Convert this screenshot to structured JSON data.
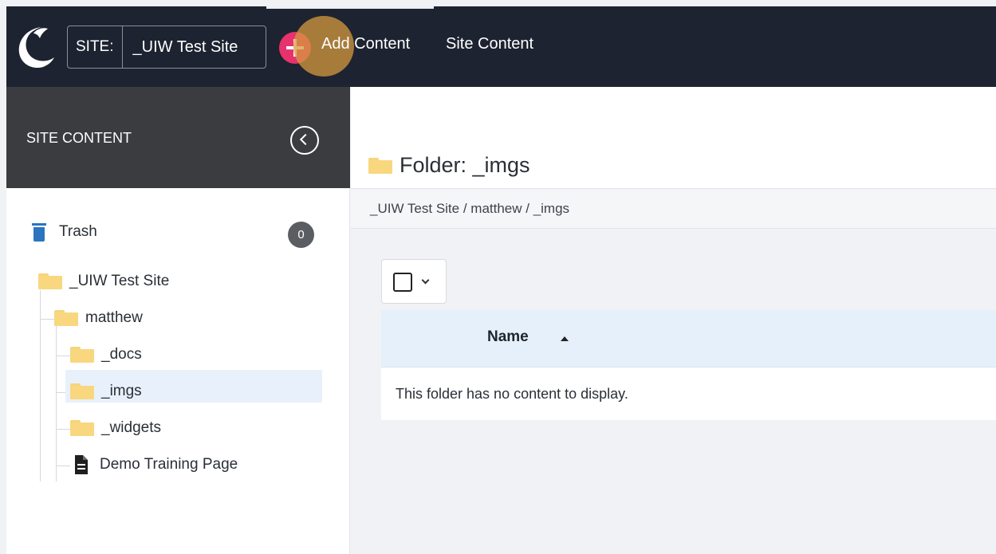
{
  "topbar": {
    "site_label": "SITE:",
    "site_value": "_UIW Test Site",
    "add_content_prefix": "Add",
    "add_content_suffix": " Content",
    "site_content": "Site Content"
  },
  "sidebar": {
    "title": "SITE CONTENT",
    "trash_label": "Trash",
    "trash_count": "0",
    "tree": {
      "site": "_UIW Test Site",
      "user": "matthew",
      "docs": "_docs",
      "imgs": "_imgs",
      "widgets": "_widgets",
      "page": "Demo Training Page"
    }
  },
  "main": {
    "folder_title": "Folder: _imgs",
    "breadcrumb": "_UIW Test Site / matthew / _imgs",
    "column_name": "Name",
    "empty_message": "This folder has no content to display."
  },
  "colors": {
    "topbar": "#1d2330",
    "accent_add": "#e8326d",
    "folder": "#f8d77f",
    "trash": "#2b74c0"
  }
}
